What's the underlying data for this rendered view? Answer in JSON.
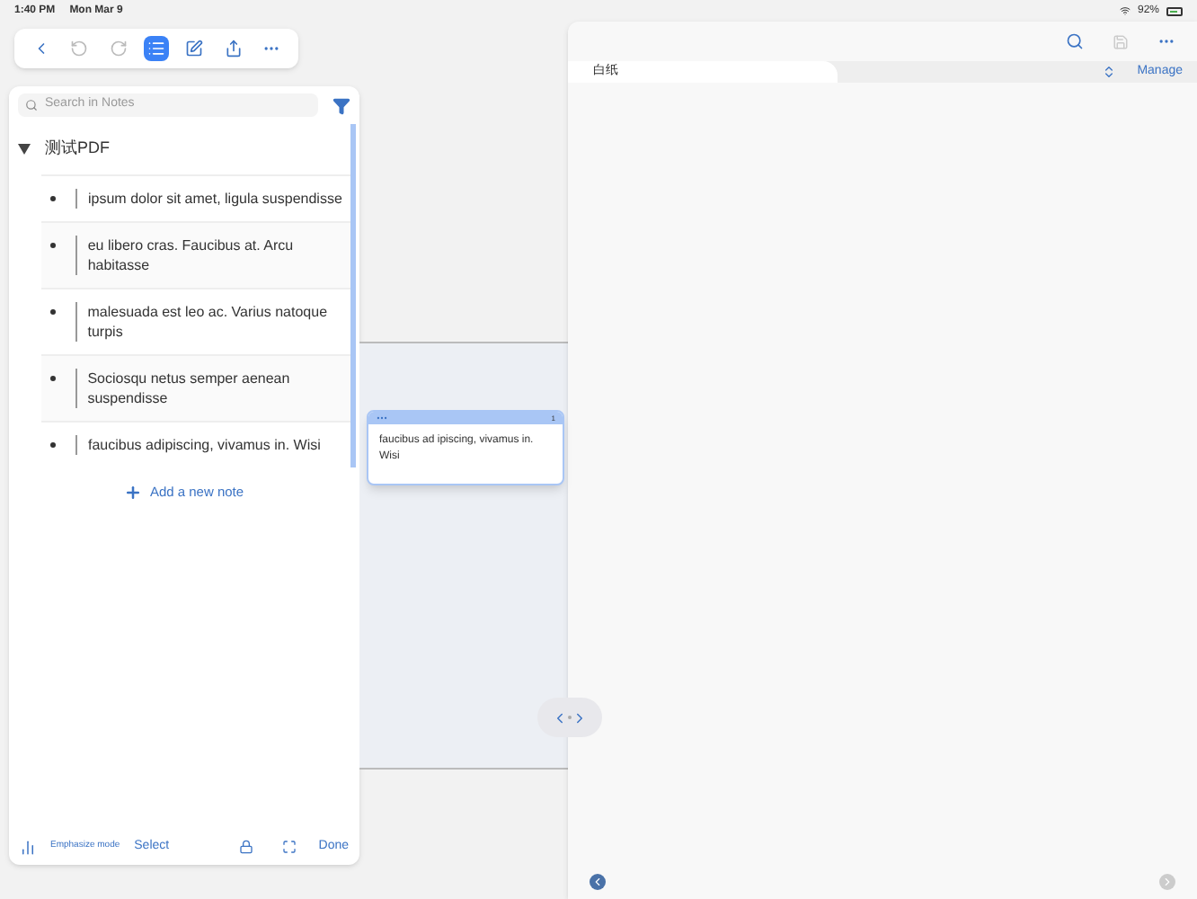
{
  "status_bar": {
    "time": "1:40 PM",
    "date": "Mon Mar 9",
    "battery_text": "92%"
  },
  "toolbar": [
    {
      "kind": "back",
      "selected": false,
      "disabled": false
    },
    {
      "kind": "undo",
      "selected": false,
      "disabled": true
    },
    {
      "kind": "redo",
      "selected": false,
      "disabled": true
    },
    {
      "kind": "list",
      "selected": true,
      "disabled": false
    },
    {
      "kind": "edit",
      "selected": false,
      "disabled": false
    },
    {
      "kind": "share",
      "selected": false,
      "disabled": false
    },
    {
      "kind": "more",
      "selected": false,
      "disabled": false
    }
  ],
  "notes_panel": {
    "search": {
      "placeholder": "Search in Notes"
    },
    "group": {
      "title": "测试PDF",
      "expanded": true,
      "notes": [
        {
          "text": "ipsum dolor sit amet, ligula suspendisse"
        },
        {
          "text": "eu libero cras. Faucibus at. Arcu habitasse"
        },
        {
          "text": "malesuada est leo ac. Varius natoque turpis"
        },
        {
          "text": "Sociosqu netus semper aenean suspendisse"
        },
        {
          "text": "faucibus adipiscing, vivamus in. Wisi"
        }
      ]
    },
    "add_note": "Add a new note",
    "footer": {
      "emphasize": "Emphasize mode",
      "select": "Select",
      "done": "Done"
    }
  },
  "floating_note": {
    "text": "faucibus ad ipiscing, vivamus in. Wisi",
    "count": "1"
  },
  "right_panel": {
    "tabs": [
      {
        "label": "白纸",
        "selected": true
      }
    ],
    "manage": "Manage"
  }
}
